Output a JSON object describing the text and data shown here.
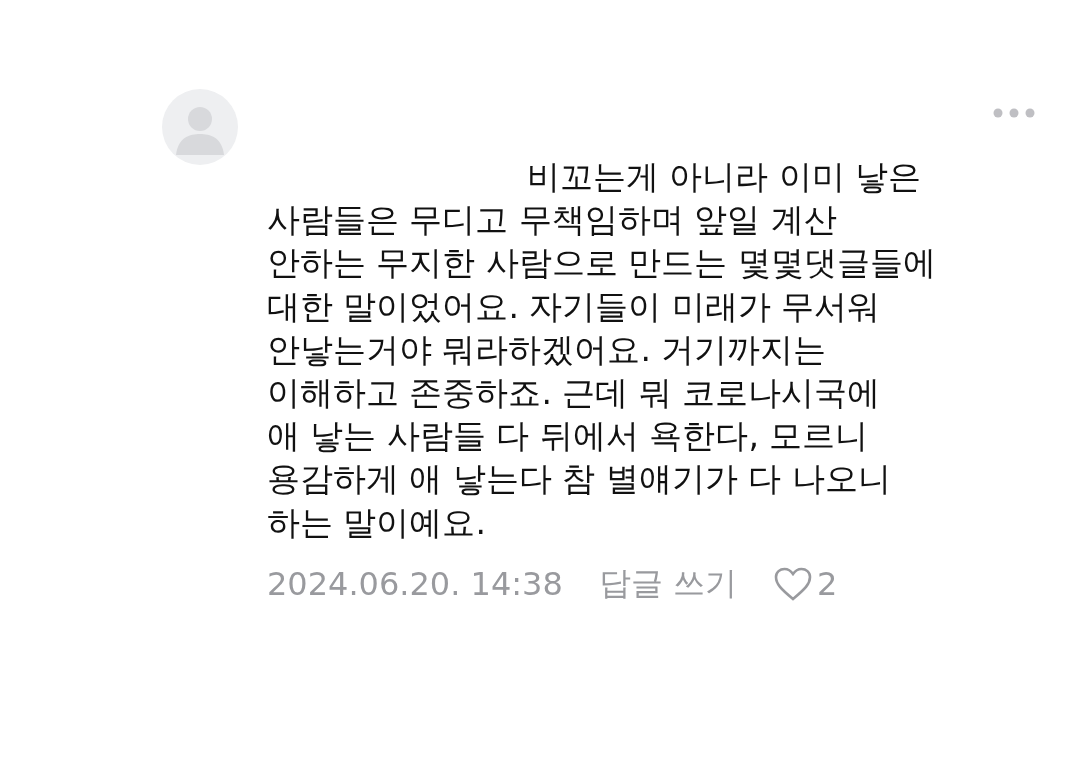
{
  "comment": {
    "body": "비꼬는게 아니라 이미 낳은\n사람들은 무디고 무책임하며 앞일 계산\n안하는 무지한 사람으로 만드는 몇몇댓글들에\n대한 말이었어요. 자기들이 미래가 무서워\n안낳는거야 뭐라하겠어요. 거기까지는\n이해하고 존중하죠. 근데 뭐 코로나시국에\n애 낳는 사람들 다 뒤에서 욕한다, 모르니\n용감하게 애 낳는다 참 별얘기가 다 나오니\n하는 말이예요.",
    "timestamp": "2024.06.20. 14:38",
    "reply": "답글 쓰기",
    "likes": "2",
    "liked": false
  }
}
